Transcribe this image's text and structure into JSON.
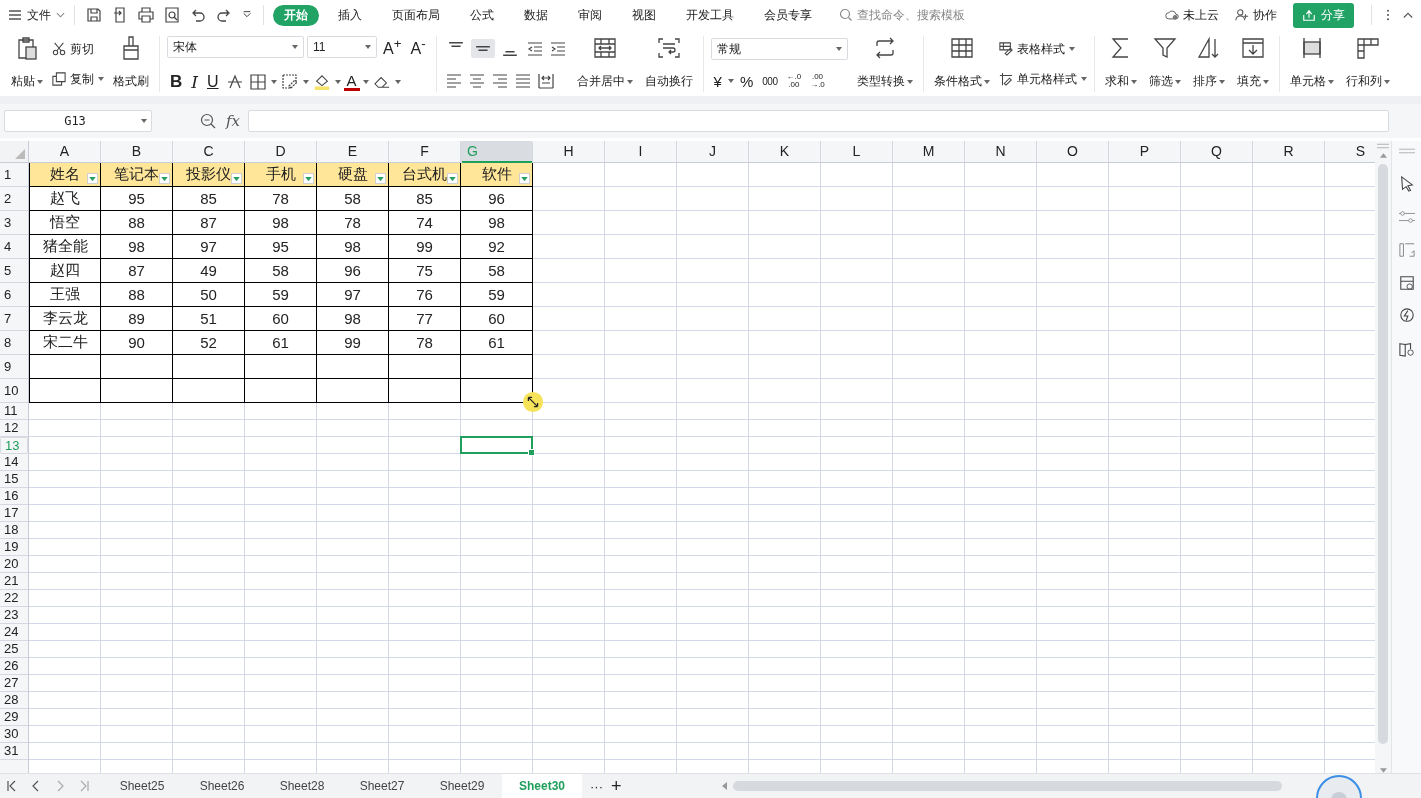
{
  "menu": {
    "file": "文件",
    "tabs": [
      {
        "label": "开始",
        "selected": true
      },
      {
        "label": "插入",
        "selected": false
      },
      {
        "label": "页面布局",
        "selected": false
      },
      {
        "label": "公式",
        "selected": false
      },
      {
        "label": "数据",
        "selected": false
      },
      {
        "label": "审阅",
        "selected": false
      },
      {
        "label": "视图",
        "selected": false
      },
      {
        "label": "开发工具",
        "selected": false
      },
      {
        "label": "会员专享",
        "selected": false
      }
    ],
    "search_placeholder": "查找命令、搜索模板",
    "cloud": "未上云",
    "collab": "协作",
    "share": "分享"
  },
  "ribbon": {
    "paste": "粘贴",
    "cut": "剪切",
    "copy": "复制",
    "format_painter": "格式刷",
    "font": "宋体",
    "font_size": "11",
    "grow_font": "A$^{+}$",
    "shrink_font": "A$^{-}$",
    "bold": "B",
    "italic": "I",
    "underline": "U",
    "font_color": "A",
    "valign": [
      {
        "selected": false
      },
      {
        "selected": true
      },
      {
        "selected": false
      }
    ],
    "merge": "合并居中",
    "wrap": "自动换行",
    "number_format": "常规",
    "currency": "¥",
    "percent": "%",
    "thousands": "000",
    "decimals": [
      {
        "top": "←.0",
        "bottom": ".00"
      },
      {
        "top": ".00",
        "bottom": "→.0"
      }
    ],
    "convert": "类型转换",
    "conditional": "条件格式",
    "table_style": "表格样式",
    "cell_style": "单元格样式",
    "sum": "求和",
    "filter": "筛选",
    "sort": "排序",
    "fill": "填充",
    "cells": "单元格",
    "rows_cols": "行和列"
  },
  "formula_bar": {
    "name_box": "G13",
    "fx": "fx"
  },
  "sheet": {
    "columns": [
      {
        "label": "A",
        "selected": false
      },
      {
        "label": "B",
        "selected": false
      },
      {
        "label": "C",
        "selected": false
      },
      {
        "label": "D",
        "selected": false
      },
      {
        "label": "E",
        "selected": false
      },
      {
        "label": "F",
        "selected": false
      },
      {
        "label": "G",
        "selected": true
      },
      {
        "label": "H",
        "selected": false
      },
      {
        "label": "I",
        "selected": false
      },
      {
        "label": "J",
        "selected": false
      },
      {
        "label": "K",
        "selected": false
      },
      {
        "label": "L",
        "selected": false
      },
      {
        "label": "M",
        "selected": false
      },
      {
        "label": "N",
        "selected": false
      },
      {
        "label": "O",
        "selected": false
      },
      {
        "label": "P",
        "selected": false
      },
      {
        "label": "Q",
        "selected": false
      },
      {
        "label": "R",
        "selected": false
      },
      {
        "label": "S",
        "selected": false
      }
    ],
    "rows": [
      {
        "label": "1",
        "selected": false
      },
      {
        "label": "2",
        "selected": false
      },
      {
        "label": "3",
        "selected": false
      },
      {
        "label": "4",
        "selected": false
      },
      {
        "label": "5",
        "selected": false
      },
      {
        "label": "6",
        "selected": false
      },
      {
        "label": "7",
        "selected": false
      },
      {
        "label": "8",
        "selected": false
      },
      {
        "label": "9",
        "selected": false
      },
      {
        "label": "10",
        "selected": false
      },
      {
        "label": "11",
        "selected": false
      },
      {
        "label": "12",
        "selected": false
      },
      {
        "label": "13",
        "selected": true
      },
      {
        "label": "14",
        "selected": false
      },
      {
        "label": "15",
        "selected": false
      },
      {
        "label": "16",
        "selected": false
      },
      {
        "label": "17",
        "selected": false
      },
      {
        "label": "18",
        "selected": false
      },
      {
        "label": "19",
        "selected": false
      },
      {
        "label": "20",
        "selected": false
      },
      {
        "label": "21",
        "selected": false
      },
      {
        "label": "22",
        "selected": false
      },
      {
        "label": "23",
        "selected": false
      },
      {
        "label": "24",
        "selected": false
      },
      {
        "label": "25",
        "selected": false
      },
      {
        "label": "26",
        "selected": false
      },
      {
        "label": "27",
        "selected": false
      },
      {
        "label": "28",
        "selected": false
      },
      {
        "label": "29",
        "selected": false
      },
      {
        "label": "30",
        "selected": false
      },
      {
        "label": "31",
        "selected": false
      }
    ],
    "table": {
      "header": [
        "姓名",
        "笔记本",
        "投影仪",
        "手机",
        "硬盘",
        "台式机",
        "软件"
      ],
      "rows": [
        [
          "赵飞",
          "95",
          "85",
          "78",
          "58",
          "85",
          "96"
        ],
        [
          "悟空",
          "88",
          "87",
          "98",
          "78",
          "74",
          "98"
        ],
        [
          "猪全能",
          "98",
          "97",
          "95",
          "98",
          "99",
          "92"
        ],
        [
          "赵四",
          "87",
          "49",
          "58",
          "96",
          "75",
          "58"
        ],
        [
          "王强",
          "88",
          "50",
          "59",
          "97",
          "76",
          "59"
        ],
        [
          "李云龙",
          "89",
          "51",
          "60",
          "98",
          "77",
          "60"
        ],
        [
          "宋二牛",
          "90",
          "52",
          "61",
          "99",
          "78",
          "61"
        ]
      ]
    }
  },
  "sheet_tabs": [
    {
      "label": "Sheet25",
      "selected": false
    },
    {
      "label": "Sheet26",
      "selected": false
    },
    {
      "label": "Sheet28",
      "selected": false
    },
    {
      "label": "Sheet27",
      "selected": false
    },
    {
      "label": "Sheet29",
      "selected": false
    },
    {
      "label": "Sheet30",
      "selected": true
    }
  ],
  "tab_more": "···",
  "tab_add": "+"
}
